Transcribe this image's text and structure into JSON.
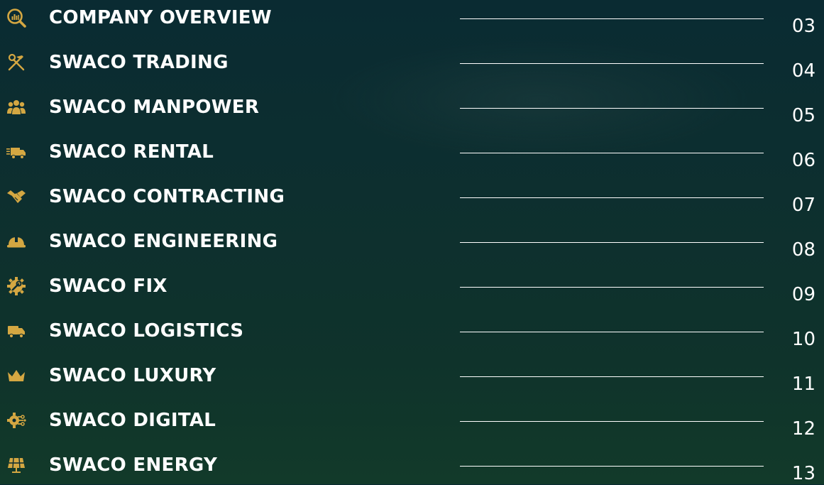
{
  "accent_color": "#d4a742",
  "text_color": "#ffffff",
  "toc": {
    "items": [
      {
        "icon": "analytics-magnifier-icon",
        "title": "COMPANY OVERVIEW",
        "page": "03"
      },
      {
        "icon": "tools-icon",
        "title": "SWACO TRADING",
        "page": "04"
      },
      {
        "icon": "people-group-icon",
        "title": "SWACO MANPOWER",
        "page": "05"
      },
      {
        "icon": "fast-truck-icon",
        "title": "SWACO RENTAL",
        "page": "06"
      },
      {
        "icon": "handshake-icon",
        "title": "SWACO CONTRACTING",
        "page": "07"
      },
      {
        "icon": "hard-hat-icon",
        "title": "SWACO ENGINEERING",
        "page": "08"
      },
      {
        "icon": "gear-wrench-icon",
        "title": "SWACO FIX",
        "page": "09"
      },
      {
        "icon": "delivery-truck-icon",
        "title": "SWACO LOGISTICS",
        "page": "10"
      },
      {
        "icon": "crown-icon",
        "title": "SWACO LUXURY",
        "page": "11"
      },
      {
        "icon": "circuit-gear-icon",
        "title": "SWACO DIGITAL",
        "page": "12"
      },
      {
        "icon": "solar-panel-icon",
        "title": "SWACO ENERGY",
        "page": "13"
      }
    ]
  }
}
